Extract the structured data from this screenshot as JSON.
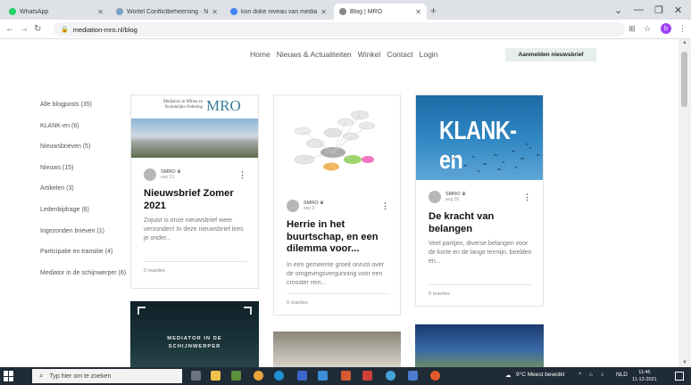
{
  "browser": {
    "tabs": [
      {
        "title": "WhatsApp",
        "active": false,
        "favicon_color": "#25d366"
      },
      {
        "title": "Wortel Conflictbeheersing · N...",
        "active": false,
        "favicon_color": "#7aa0c4"
      },
      {
        "title": "kon doke niveau van mediator",
        "active": false,
        "favicon_color": "#4285f4"
      },
      {
        "title": "Blog | MRO",
        "active": true,
        "favicon_color": "#888888"
      }
    ],
    "new_tab_icon": "plus-icon",
    "url": "mediation-mro.nl/blog",
    "profile_initial": "b"
  },
  "site_nav": {
    "links": [
      "Home",
      "Nieuws & Actualiteiten",
      "Winkel",
      "Contact",
      "Login"
    ],
    "subscribe_label": "Aanmelden nieuwsbrief"
  },
  "sidebar": {
    "categories": [
      "Alle blogposts (35)",
      "KLANK-en (6)",
      "Nieuwsbrieven (5)",
      "Nieuws (15)",
      "Artikelen (3)",
      "Ledenbijdrage (6)",
      "Ingezonden brieven (1)",
      "Participatie en transitie (4)",
      "Mediator in de schijnwerper (6)"
    ]
  },
  "posts": [
    {
      "author": "SMRO ♛",
      "date": "sep 13",
      "title": "Nieuwsbrief Zomer 2021",
      "excerpt": "Zojuist is onze nieuwsbrief weer verzonden! In deze nieuwsbrief lees je onder...",
      "reactions": "0 reacties",
      "image_text_small": "Mediators in Milieu en Ruimtelijke Ordening",
      "image_text_big": "MRO"
    },
    {
      "author": "SMRO ♛",
      "date": "sep 9",
      "title": "Herrie in het buurtschap, en een dilemma voor...",
      "excerpt": "In een gemeente groeit onrust over de omgevingsvergunning voor een crosster rein...",
      "reactions": "0 reacties"
    },
    {
      "author": "SMRO ♛",
      "date": "aug 30",
      "title": "De kracht van belangen",
      "excerpt": "Veel partijen, diverse belangen voor de korte en de lange termijn, beelden en...",
      "reactions": "0 reacties",
      "image_text": "KLANK-en"
    }
  ],
  "lower_cards": {
    "mediator_text_1": "MEDIATOR IN DE",
    "mediator_text_2": "SCHIJNWERPER"
  },
  "taskbar": {
    "search_placeholder": "Typ hier om te zoeken",
    "weather": "9°C  Meest bewolkt",
    "lang": "NLD",
    "time": "11:45",
    "date": "11-12-2021"
  },
  "colors": {
    "accent_green": "#e6efe9",
    "klank_blue": "#2f86c2",
    "mro_teal": "#3a7c99",
    "taskbar": "#1f2b36"
  }
}
